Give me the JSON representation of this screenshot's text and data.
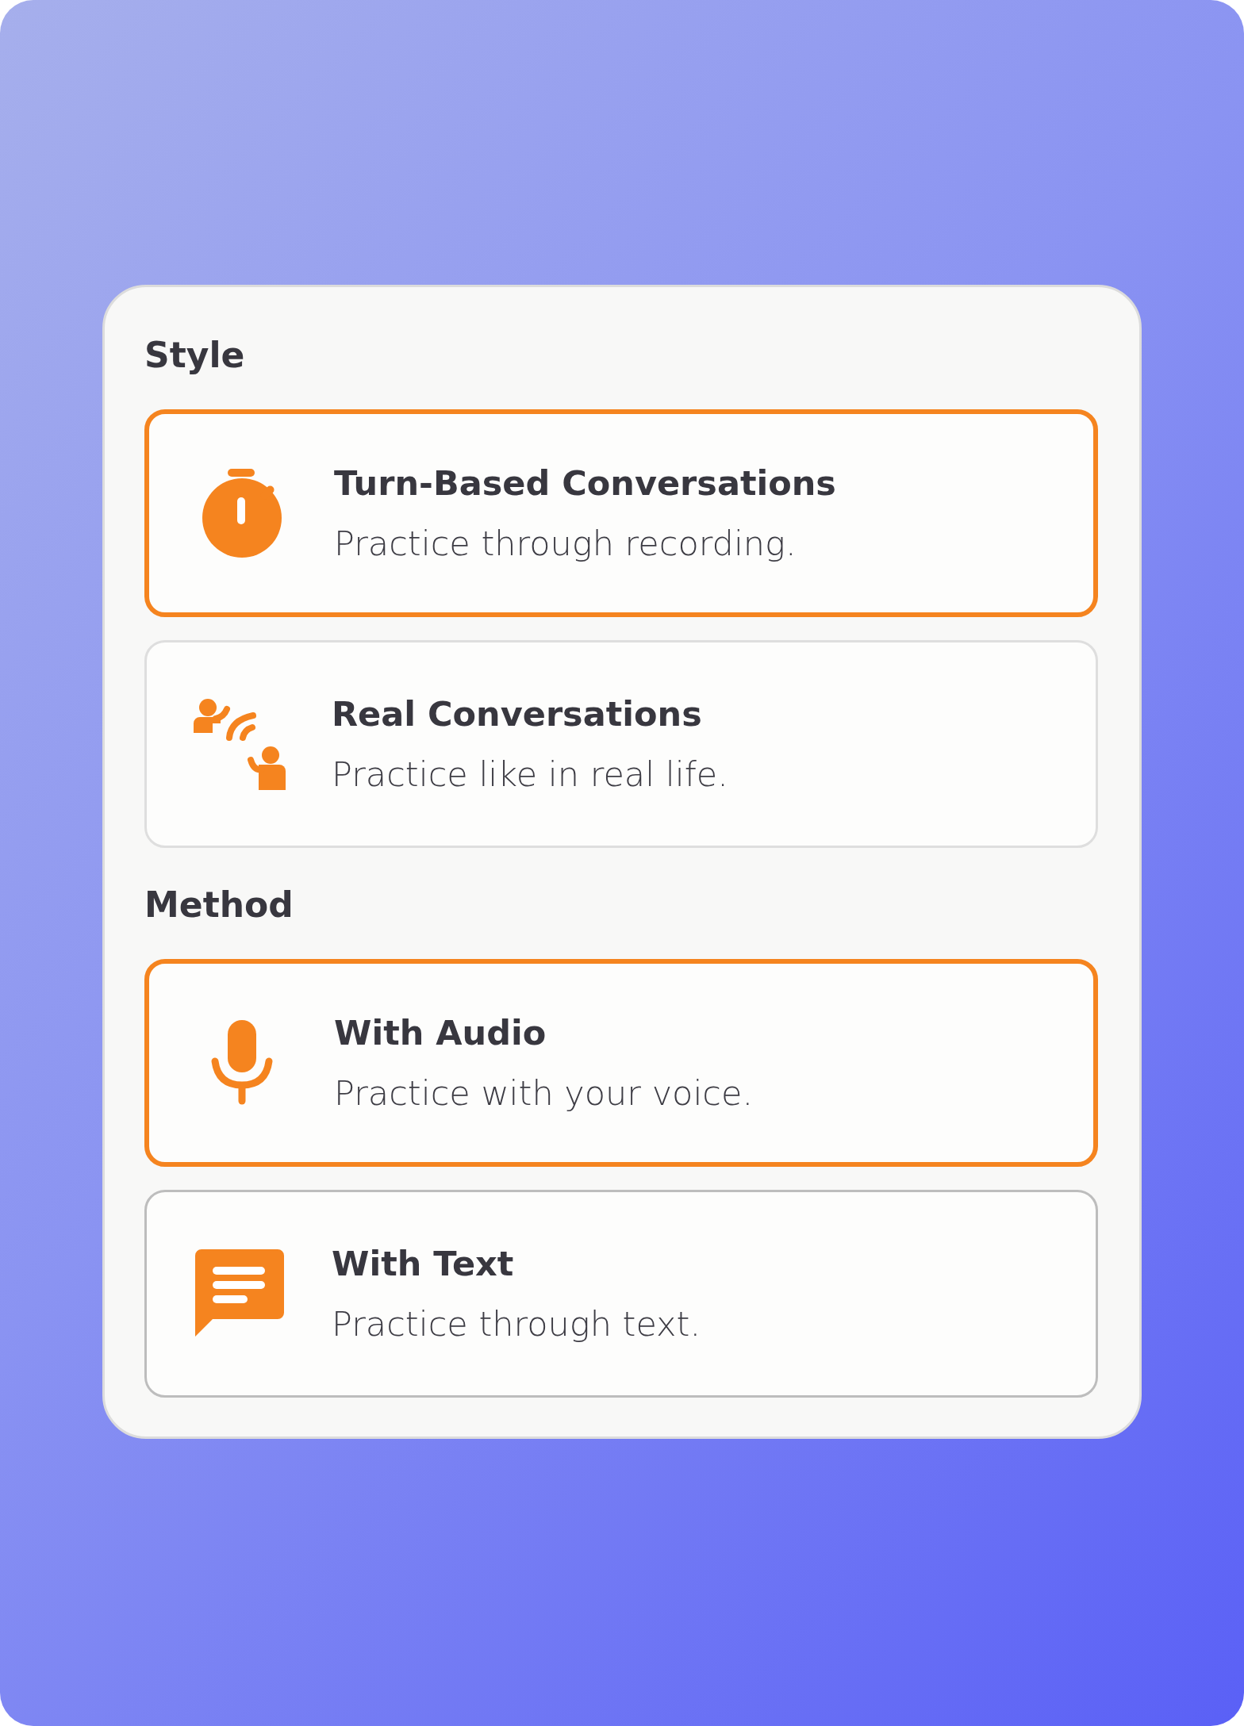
{
  "sections": [
    {
      "heading": "Style",
      "options": [
        {
          "kind": "timer",
          "title": "Turn-Based Conversations",
          "subtitle": "Practice through recording.",
          "selected": true,
          "hovered": false
        },
        {
          "kind": "talk",
          "title": "Real Conversations",
          "subtitle": "Practice like in real life.",
          "selected": false,
          "hovered": false
        }
      ]
    },
    {
      "heading": "Method",
      "options": [
        {
          "kind": "mic",
          "title": "With Audio",
          "subtitle": "Practice with your voice.",
          "selected": true,
          "hovered": false
        },
        {
          "kind": "chat",
          "title": "With Text",
          "subtitle": "Practice through text.",
          "selected": false,
          "hovered": true
        }
      ]
    }
  ]
}
